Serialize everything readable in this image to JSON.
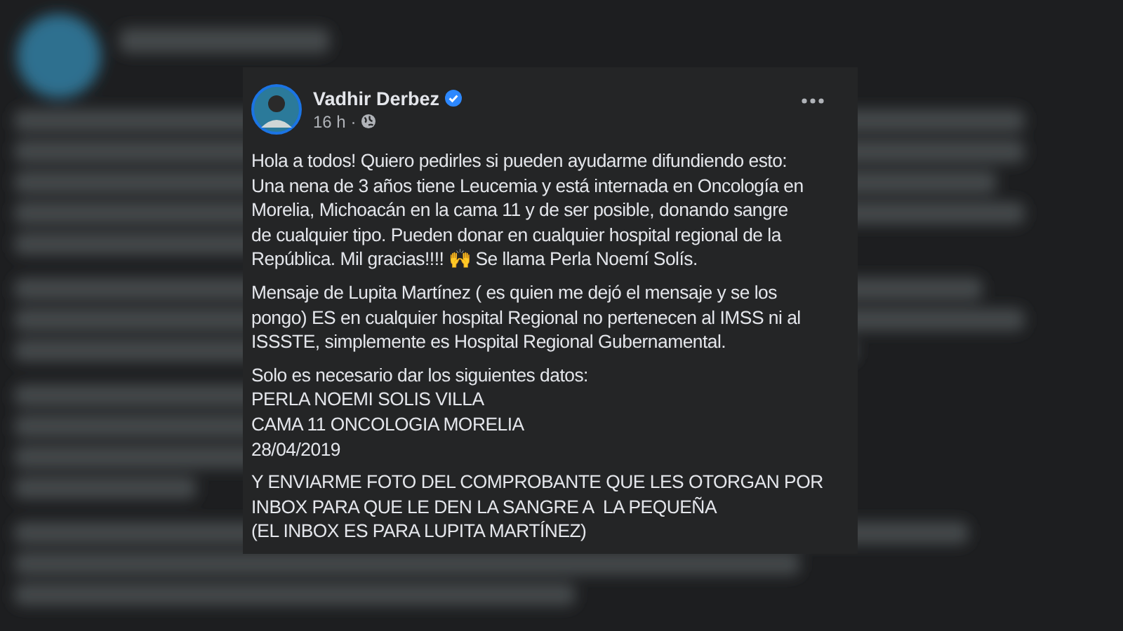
{
  "post": {
    "author": "Vadhir Derbez",
    "verified": true,
    "time": "16 h ·",
    "paragraphs": [
      {
        "lines": [
          "Hola a todos! Quiero pedirles si pueden ayudarme difundiendo esto:",
          "Una nena de 3 años tiene Leucemia y está internada en Oncología en",
          "Morelia, Michoacán en la cama 11 y de ser posible, donando sangre",
          "de cualquier tipo. Pueden donar en cualquier hospital regional de la",
          "República. Mil gracias!!!! 🙌 Se llama Perla Noemí Solís."
        ]
      },
      {
        "lines": [
          "Mensaje de Lupita Martínez ( es quien me dejó el mensaje y se los",
          "pongo) ES en cualquier hospital Regional no pertenecen al IMSS ni al",
          "ISSSTE, simplemente es Hospital Regional Gubernamental."
        ]
      },
      {
        "lines": [
          "Solo es necesario dar los siguientes datos:",
          "PERLA NOEMI SOLIS VILLA",
          "CAMA 11 ONCOLOGIA MORELIA",
          "28/04/2019"
        ]
      },
      {
        "lines": [
          "Y ENVIARME FOTO DEL COMPROBANTE QUE LES OTORGAN POR",
          "INBOX PARA QUE LE DEN LA SANGRE A  LA PEQUEÑA",
          "(EL INBOX ES PARA LUPITA MARTÍNEZ)"
        ]
      }
    ]
  }
}
